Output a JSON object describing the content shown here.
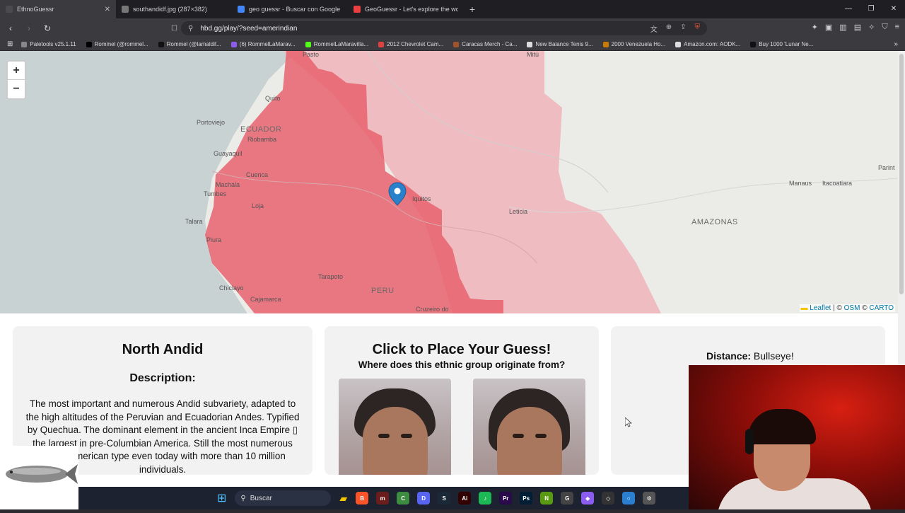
{
  "browser": {
    "tabs": [
      {
        "label": "EthnoGuessr",
        "active": true,
        "icon_color": "#4a4a4f"
      },
      {
        "label": "southandidf.jpg (287×382)",
        "active": false,
        "icon_color": "#777"
      },
      {
        "label": "geo guessr - Buscar con Google",
        "active": false,
        "icon_color": "#4285f4"
      },
      {
        "label": "GeoGuessr - Let's explore the world!",
        "active": false,
        "icon_color": "#e84040"
      }
    ],
    "url": "hbd.gg/play/?seed=amerindian",
    "bookmarks": [
      {
        "label": "Paletools v25.1.11",
        "color": "#888"
      },
      {
        "label": "Rommel (@rommel...",
        "color": "#000"
      },
      {
        "label": "Rommel (@lamaldit...",
        "color": "#111"
      },
      {
        "label": "(6) RommelLaMarav...",
        "color": "#8c5cf0"
      },
      {
        "label": "RommelLaMaravilla...",
        "color": "#53fc18"
      },
      {
        "label": "2012 Chevrolet Cam...",
        "color": "#e04040"
      },
      {
        "label": "Caracas Merch - Ca...",
        "color": "#a0522d"
      },
      {
        "label": "New Balance Tenis 9...",
        "color": "#ddd"
      },
      {
        "label": "2000 Venezuela Ho...",
        "color": "#c97a00"
      },
      {
        "label": "Amazon.com: AODK...",
        "color": "#ddd"
      },
      {
        "label": "Buy 1000 'Lunar Ne...",
        "color": "#111"
      }
    ]
  },
  "map": {
    "zoom_in": "+",
    "zoom_out": "−",
    "labels": [
      {
        "text": "Pasto",
        "cls": "city"
      },
      {
        "text": "Mitú",
        "cls": "city"
      },
      {
        "text": "Quito",
        "cls": "city"
      },
      {
        "text": "Portoviejo",
        "cls": "city"
      },
      {
        "text": "ECUADOR",
        "cls": "country"
      },
      {
        "text": "Riobamba",
        "cls": "city"
      },
      {
        "text": "Guayaquil",
        "cls": "city"
      },
      {
        "text": "Cuenca",
        "cls": "city"
      },
      {
        "text": "Machala",
        "cls": "city"
      },
      {
        "text": "Tumbes",
        "cls": "city"
      },
      {
        "text": "Loja",
        "cls": "city"
      },
      {
        "text": "Talara",
        "cls": "city"
      },
      {
        "text": "Piura",
        "cls": "city"
      },
      {
        "text": "Iquitos",
        "cls": "city"
      },
      {
        "text": "Leticia",
        "cls": "city"
      },
      {
        "text": "Manaus",
        "cls": "city"
      },
      {
        "text": "Itacoatiara",
        "cls": "city"
      },
      {
        "text": "Parint",
        "cls": "city"
      },
      {
        "text": "AMAZONAS",
        "cls": "country"
      },
      {
        "text": "Tarapoto",
        "cls": "city"
      },
      {
        "text": "PERU",
        "cls": "country"
      },
      {
        "text": "Chiclayo",
        "cls": "city"
      },
      {
        "text": "Cajamarca",
        "cls": "city"
      },
      {
        "text": "Cruzeiro do",
        "cls": "city"
      }
    ],
    "attribution": {
      "leaflet": "Leaflet",
      "sep": " | © ",
      "osm": "OSM",
      "carto": "CARTO"
    },
    "region_color": "#e8636e",
    "outer_color": "#efb8bd"
  },
  "info": {
    "title": "North Andid",
    "desc_heading": "Description:",
    "description": "The most important and numerous Andid subvariety, adapted to the high altitudes of the Peruvian and Ecuadorian Andes. Typified by Quechua. The dominant element in the ancient Inca Empire ▯ the largest in pre-Columbian America. Still the most numerous Native American type even today with more than 10 million individuals."
  },
  "guess": {
    "title": "Click to Place Your Guess!",
    "subtitle": "Where does this ethnic group originate from?"
  },
  "result": {
    "distance_label": "Distance:",
    "distance_value": "Bullseye!"
  },
  "taskbar": {
    "search_placeholder": "Buscar",
    "apps": [
      {
        "name": "brave",
        "color": "#fb542b",
        "glyph": "B"
      },
      {
        "name": "mailchimp",
        "color": "#6b1d1d",
        "glyph": "m"
      },
      {
        "name": "chrome",
        "color": "#3c8d40",
        "glyph": "C"
      },
      {
        "name": "discord",
        "color": "#5865f2",
        "glyph": "D"
      },
      {
        "name": "steam",
        "color": "#1b2838",
        "glyph": "S"
      },
      {
        "name": "illustrator",
        "color": "#330000",
        "glyph": "Ai"
      },
      {
        "name": "spotify",
        "color": "#1db954",
        "glyph": "♪"
      },
      {
        "name": "premiere",
        "color": "#2a0a4a",
        "glyph": "Pr"
      },
      {
        "name": "photoshop",
        "color": "#001e36",
        "glyph": "Ps"
      },
      {
        "name": "nvidia",
        "color": "#5a9a10",
        "glyph": "N"
      },
      {
        "name": "app",
        "color": "#444",
        "glyph": "G"
      },
      {
        "name": "copilot",
        "color": "#8a5cf0",
        "glyph": "◆"
      },
      {
        "name": "vpn",
        "color": "#333",
        "glyph": "◇"
      },
      {
        "name": "browser",
        "color": "#2a7fd0",
        "glyph": "○"
      },
      {
        "name": "settings",
        "color": "#555",
        "glyph": "⚙"
      }
    ]
  }
}
